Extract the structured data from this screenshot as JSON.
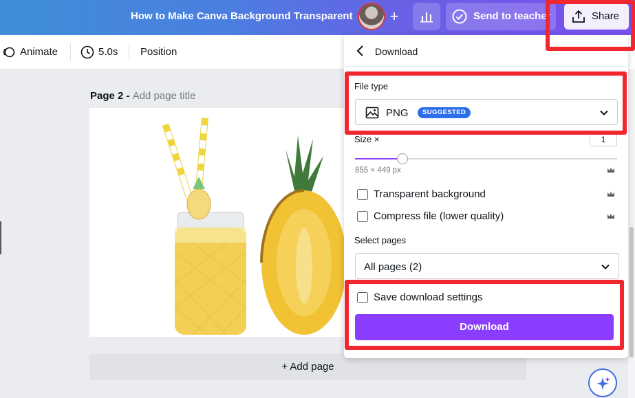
{
  "topbar": {
    "title": "How to Make Canva Background Transparent",
    "send_label": "Send to teacher",
    "share_label": "Share"
  },
  "toolbar": {
    "animate": "Animate",
    "duration": "5.0s",
    "position": "Position"
  },
  "canvas": {
    "page_label": "Page 2 - ",
    "page_title_placeholder": "Add page title",
    "add_page": "+ Add page"
  },
  "panel": {
    "title": "Download",
    "file_type_label": "File type",
    "file_type_value": "PNG",
    "suggested_badge": "SUGGESTED",
    "size_label": "Size ×",
    "size_value": "1",
    "size_fraction": 0.18,
    "dimensions": "855 × 449 px",
    "transparent_bg": "Transparent background",
    "compress": "Compress file (lower quality)",
    "select_pages_label": "Select pages",
    "select_pages_value": "All pages (2)",
    "save_settings": "Save download settings",
    "download_button": "Download"
  },
  "colors": {
    "accent": "#8b3dff",
    "badge": "#2a6ee8",
    "highlight": "#f0272e"
  }
}
